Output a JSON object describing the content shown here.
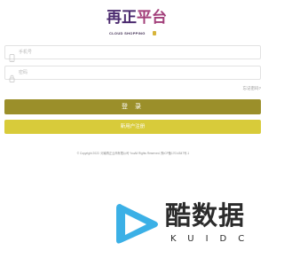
{
  "logo": {
    "cn_part1": "再正",
    "cn_part2": "平台",
    "en": "CLOUD SHOPPING"
  },
  "form": {
    "phone_placeholder": "手机号",
    "password_placeholder": "密码",
    "forgot_label": "忘记密码?",
    "login_label": "登 录",
    "register_label": "新用户注册"
  },
  "footer": {
    "text": "© Copyright 2022. 河南再正云商有限公司 YouAll Rights Reserved. 豫ICP备17014547号-1"
  },
  "watermark": {
    "cn": "酷数据",
    "en": "KUIDC"
  },
  "colors": {
    "login": "#9b8f2a",
    "register": "#d8cb3a",
    "watermark_blue": "#3bb0e6"
  }
}
